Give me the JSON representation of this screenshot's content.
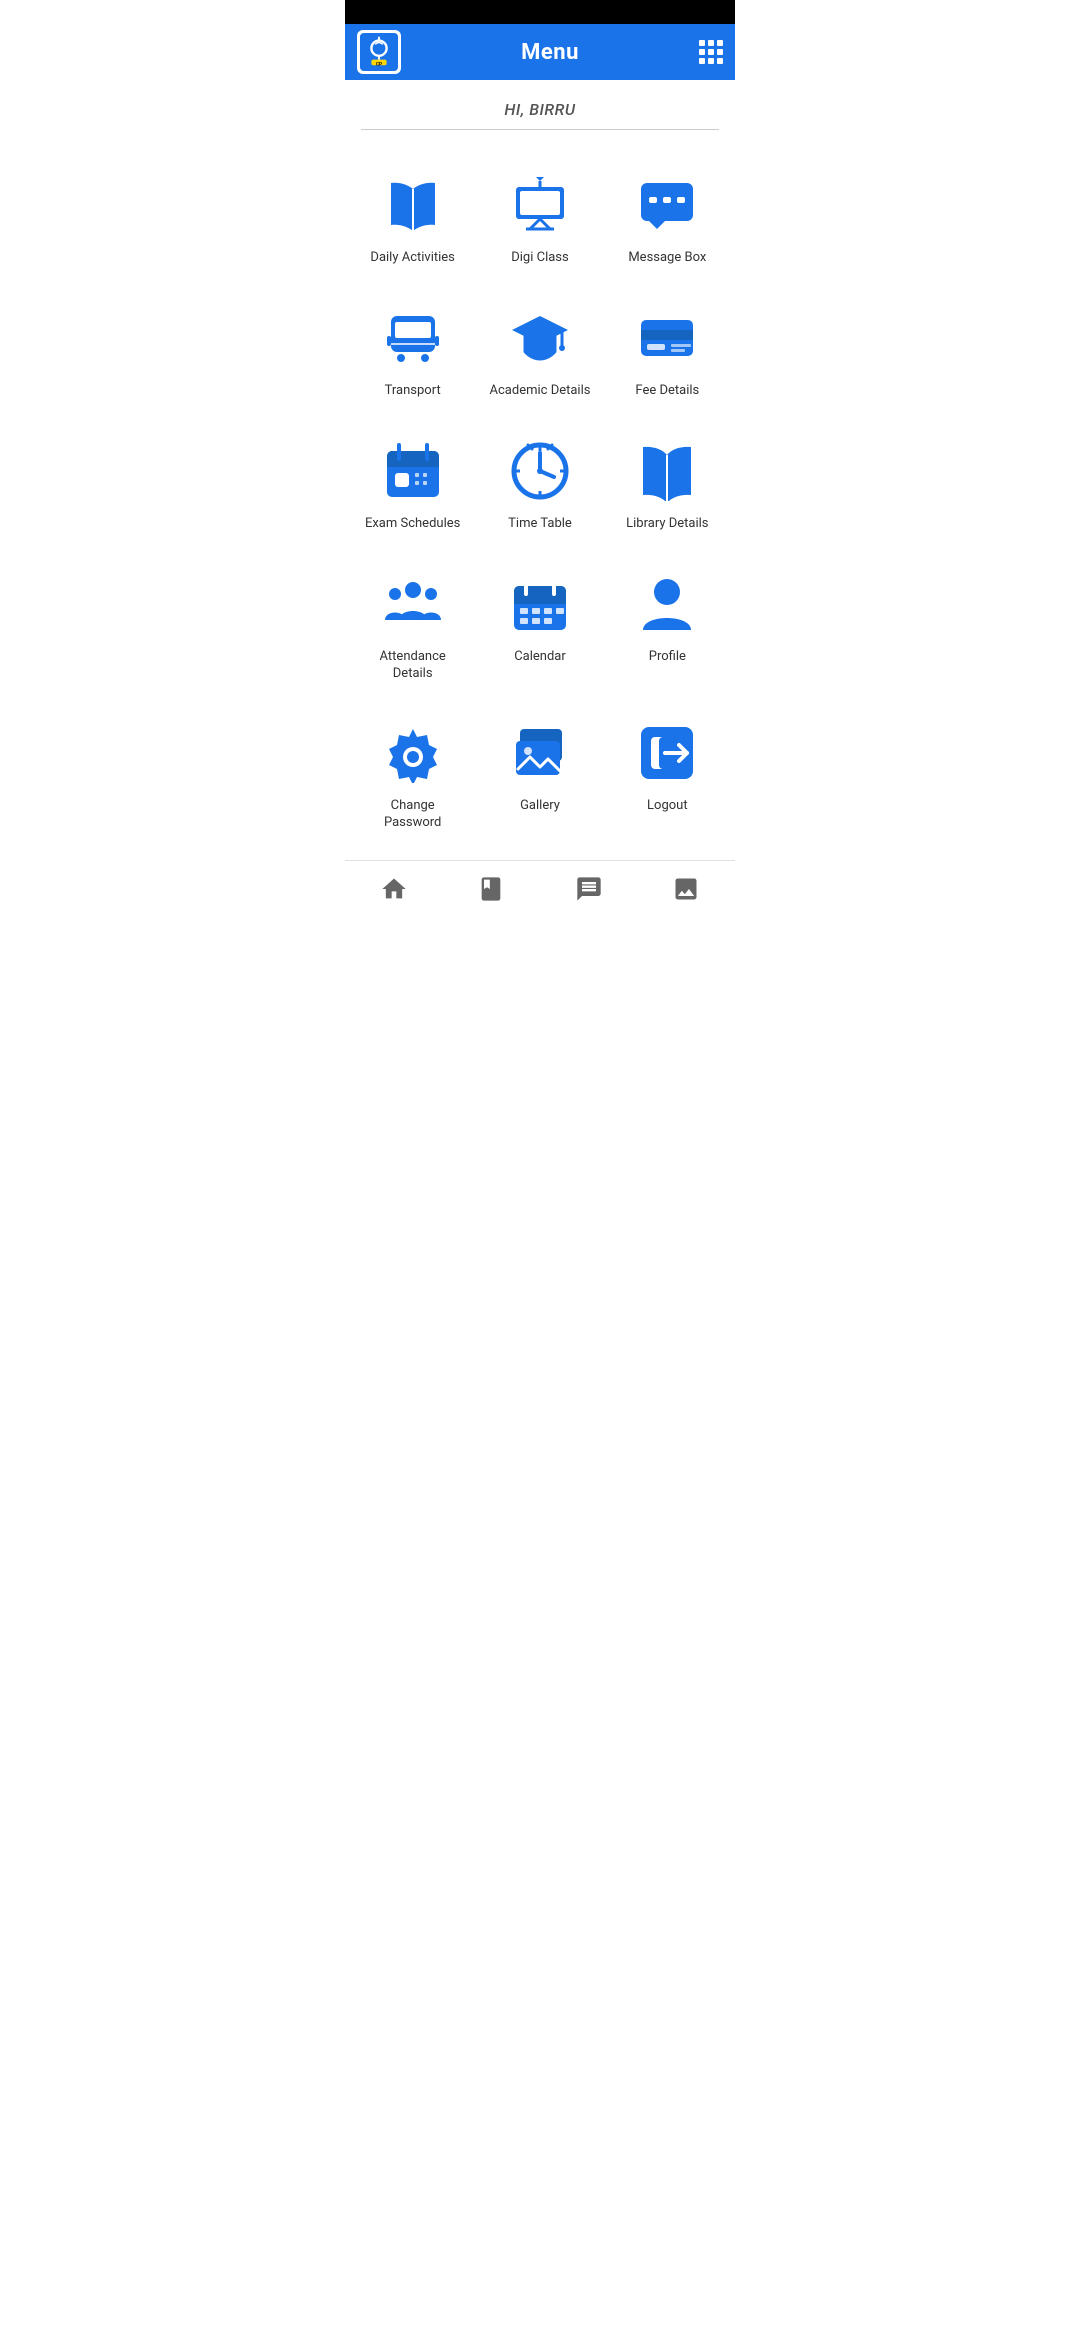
{
  "statusBar": {},
  "header": {
    "title": "Menu",
    "gridIconLabel": "grid-menu"
  },
  "greeting": {
    "text": "HI, BIRRU"
  },
  "menuItems": [
    {
      "id": "daily-activities",
      "label": "Daily Activities",
      "icon": "book"
    },
    {
      "id": "digi-class",
      "label": "Digi Class",
      "icon": "projector"
    },
    {
      "id": "message-box",
      "label": "Message Box",
      "icon": "message"
    },
    {
      "id": "transport",
      "label": "Transport",
      "icon": "bus"
    },
    {
      "id": "academic-details",
      "label": "Academic Details",
      "icon": "graduation"
    },
    {
      "id": "fee-details",
      "label": "Fee Details",
      "icon": "card"
    },
    {
      "id": "exam-schedules",
      "label": "Exam Schedules",
      "icon": "calendar-event"
    },
    {
      "id": "time-table",
      "label": "Time Table",
      "icon": "clock"
    },
    {
      "id": "library-details",
      "label": "Library Details",
      "icon": "library"
    },
    {
      "id": "attendance-details",
      "label": "Attendance Details",
      "icon": "group"
    },
    {
      "id": "calendar",
      "label": "Calendar",
      "icon": "calendar"
    },
    {
      "id": "profile",
      "label": "Profile",
      "icon": "person"
    },
    {
      "id": "change-password",
      "label": "Change Password",
      "icon": "gear"
    },
    {
      "id": "gallery",
      "label": "Gallery",
      "icon": "images"
    },
    {
      "id": "logout",
      "label": "Logout",
      "icon": "logout"
    }
  ],
  "bottomNav": [
    {
      "id": "home",
      "icon": "home"
    },
    {
      "id": "library",
      "icon": "book"
    },
    {
      "id": "messages",
      "icon": "chat"
    },
    {
      "id": "gallery",
      "icon": "image"
    }
  ]
}
